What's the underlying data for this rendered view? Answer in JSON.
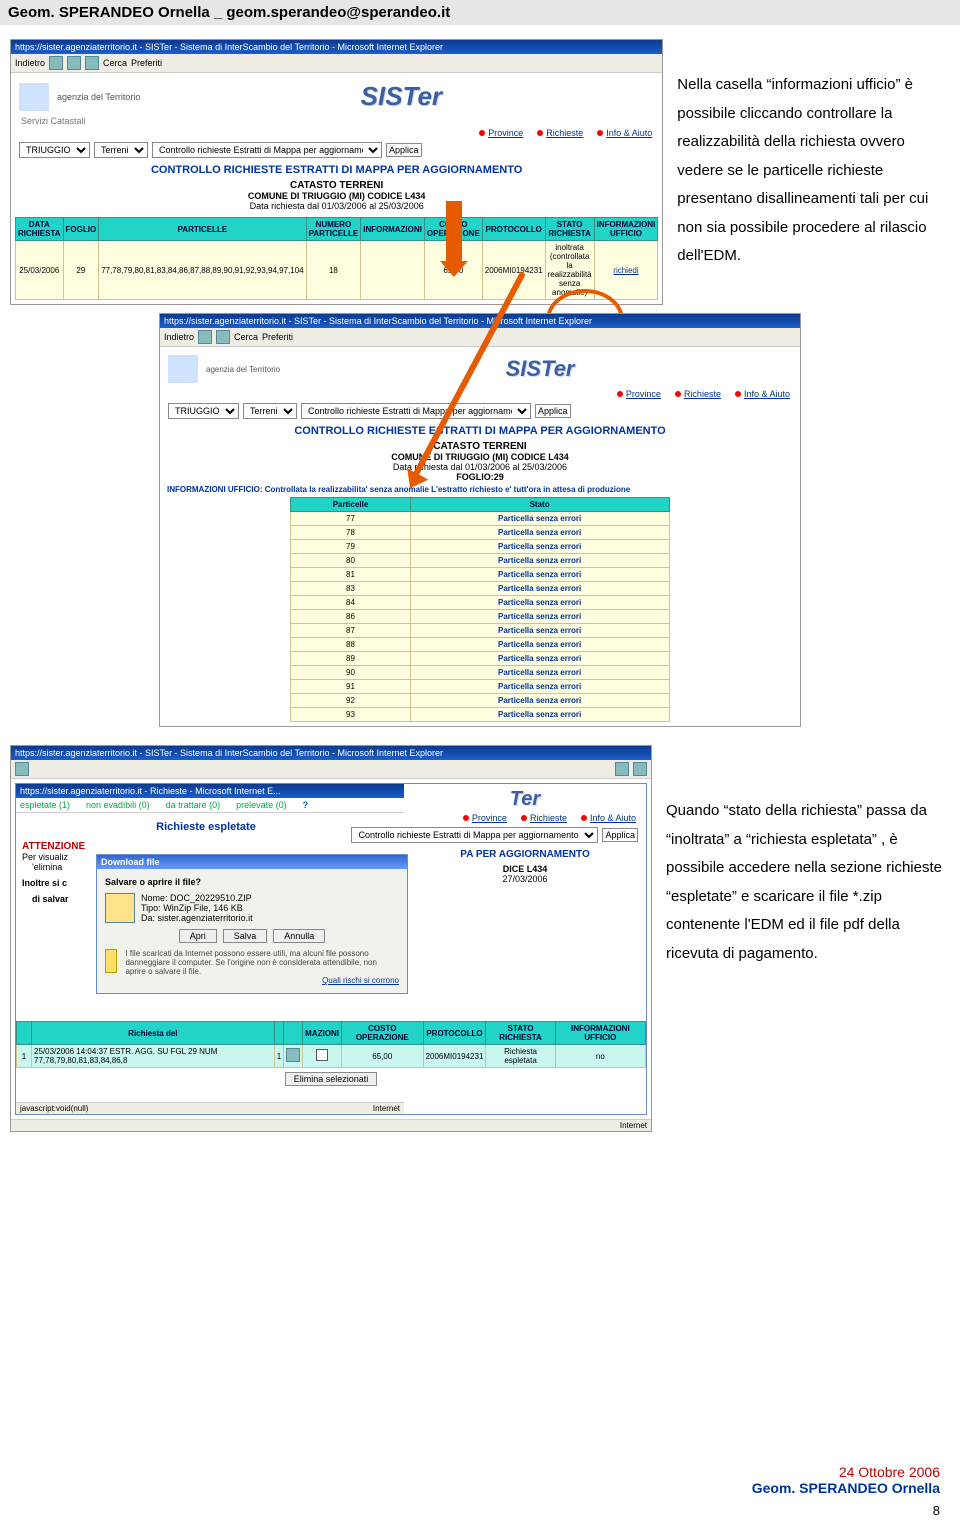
{
  "header": {
    "text": "Geom. SPERANDEO Ornella _ geom.sperandeo@sperandeo.it"
  },
  "para1": "Nella casella “informazioni ufficio” è possibile cliccando controllare la realizzabilità della richiesta ovvero vedere se le particelle richieste presentano disallineamenti tali per cui non sia possibile procedere al rilascio dell'EDM.",
  "para2": "Quando “stato della richiesta” passa da “inoltrata” a “richiesta espletata” , è possibile accedere nella sezione richieste “espletate” e scaricare il file *.zip contenente l'EDM ed il file pdf della ricevuta di pagamento.",
  "sc": {
    "win_title": "https://sister.agenziaterritorio.it - SISTer - Sistema di InterScambio del Territorio - Microsoft Internet Explorer",
    "back": "Indietro",
    "search": "Cerca",
    "fav": "Preferiti",
    "agency": "agenzia del Territorio",
    "servizi": "Servizi Catastali",
    "brand": "SISTer",
    "nav": {
      "prov": "Province",
      "rich": "Richieste",
      "info": "Info & Aiuto"
    },
    "filt": {
      "comune": "TRIUGGIO",
      "terr": "Terreni",
      "ctrl": "Controllo richieste Estratti di Mappa per aggiornamento",
      "applica": "Applica"
    },
    "t1": "CONTROLLO RICHIESTE ESTRATTI DI MAPPA PER AGGIORNAMENTO",
    "t2": "CATASTO TERRENI",
    "t3": "COMUNE DI TRIUGGIO (MI)  CODICE  L434",
    "t4": "Data richiesta dal 01/03/2006 al 25/03/2006",
    "tbl1": {
      "hd": [
        "DATA RICHIESTA",
        "FOGLIO",
        "PARTICELLE",
        "NUMERO PARTICELLE",
        "INFORMAZIONI",
        "COSTO OPERAZIONE",
        "PROTOCOLLO",
        "STATO RICHIESTA",
        "INFORMAZIONI UFFICIO"
      ],
      "row": [
        "25/03/2006",
        "29",
        "77,78,79,80,81,83,84,86,87,88,89,90,91,92,93,94,97,104",
        "18",
        "",
        "65,00",
        "2006MI0194231",
        "inoltrata (controllata la realizzabilità senza anomalie)",
        "richiedi"
      ]
    }
  },
  "sc2": {
    "foglio": "FOGLIO:29",
    "info_line": "INFORMAZIONI UFFICIO: Controllata la realizzabilita' senza anomalie L'estratto richiesto e' tutt'ora in attesa di produzione",
    "hd": [
      "Particelle",
      "Stato"
    ],
    "rows": [
      [
        "77",
        "Particella senza errori"
      ],
      [
        "78",
        "Particella senza errori"
      ],
      [
        "79",
        "Particella senza errori"
      ],
      [
        "80",
        "Particella senza errori"
      ],
      [
        "81",
        "Particella senza errori"
      ],
      [
        "83",
        "Particella senza errori"
      ],
      [
        "84",
        "Particella senza errori"
      ],
      [
        "86",
        "Particella senza errori"
      ],
      [
        "87",
        "Particella senza errori"
      ],
      [
        "88",
        "Particella senza errori"
      ],
      [
        "89",
        "Particella senza errori"
      ],
      [
        "90",
        "Particella senza errori"
      ],
      [
        "91",
        "Particella senza errori"
      ],
      [
        "92",
        "Particella senza errori"
      ],
      [
        "93",
        "Particella senza errori"
      ]
    ]
  },
  "sc3": {
    "popup_title": "https://sister.agenziaterritorio.it - Richieste - Microsoft Internet E...",
    "strip": {
      "esp": "espletate (1)",
      "nev": "non evadibili (0)",
      "trat": "da trattare (0)",
      "prel": "prelevate (0)"
    },
    "h_esp": "Richieste espletate",
    "att": "ATTENZIONE",
    "att2": "Per visualiz",
    "att3": "'elimina",
    "att4": "Inoltre si c",
    "att5": "di salvar",
    "dl": {
      "title": "Download file",
      "q": "Salvare o aprire il file?",
      "nome_l": "Nome:",
      "nome": "DOC_20229510.ZIP",
      "tipo_l": "Tipo:",
      "tipo": "WinZip File, 146 KB",
      "da_l": "Da:",
      "da": "sister.agenziaterritorio.it",
      "b1": "Apri",
      "b2": "Salva",
      "b3": "Annulla",
      "warn": "I file scaricati da Internet possono essere utili, ma alcuni file possono danneggiare il computer. Se l'origine non è considerata attendibile, non aprire o salvare il file.",
      "risk": "Quali rischi si corrono"
    },
    "pa": "PA PER AGGIORNAMENTO",
    "dice": "DICE  L434",
    "date": "27/03/2006",
    "tbl": {
      "hd": [
        "",
        "Richiesta del",
        "",
        "",
        "",
        "MAZIONI",
        "COSTO OPERAZIONE",
        "PROTOCOLLO",
        "STATO RICHIESTA",
        "INFORMAZIONI UFFICIO"
      ],
      "row_time": "25/03/2006 14:04:37",
      "row_desc": "ESTR. AGG. SU FGL 29 NUM 77,78,79,80,81,83,84,86,8",
      "row_n": "1",
      "row_cost": "65,00",
      "row_prot": "2006MI0194231",
      "row_stat": "Richiesta espletata",
      "row_info": "no"
    },
    "elim": "Elimina selezionati",
    "js": "javascript:void(null)",
    "inet": "Internet"
  },
  "footer": {
    "date": "24 Ottobre 2006",
    "name": "Geom. SPERANDEO Ornella",
    "page": "8"
  }
}
